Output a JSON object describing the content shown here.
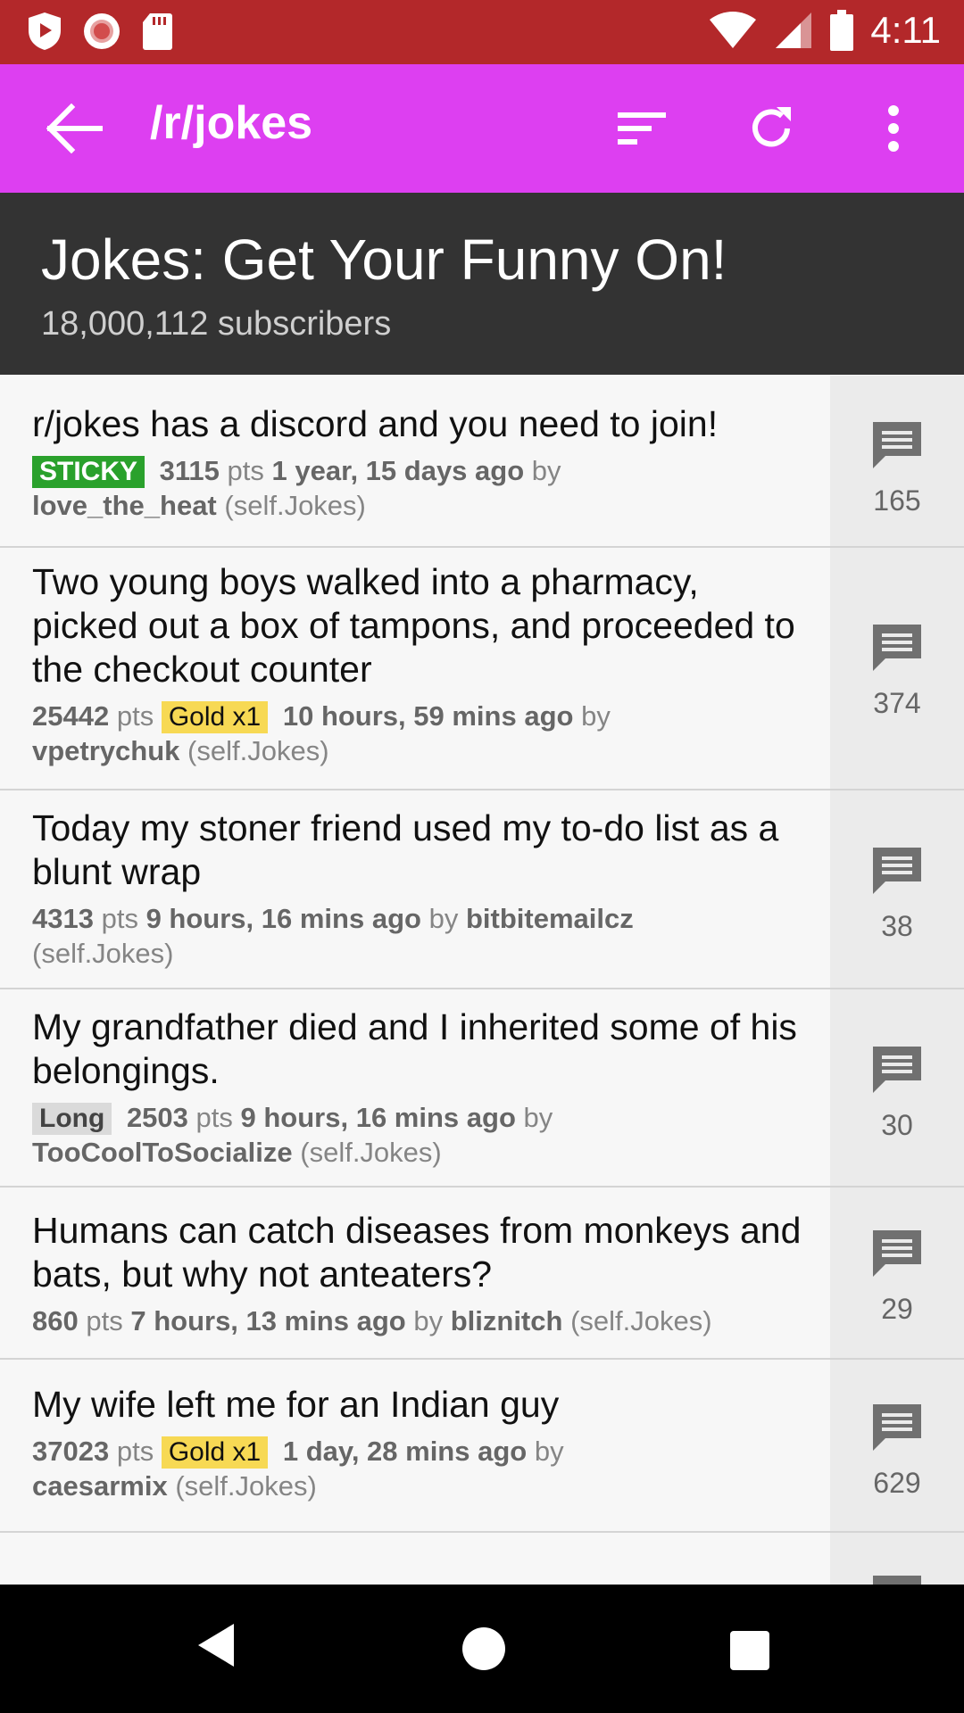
{
  "status_bar": {
    "time": "4:11",
    "icons": [
      "shield-icon",
      "record-icon",
      "sdcard-icon",
      "wifi-icon",
      "signal-icon",
      "battery-icon"
    ]
  },
  "app_bar": {
    "title": "/r/jokes",
    "icons": [
      "back-arrow-icon",
      "sort-icon",
      "refresh-icon",
      "more-vert-icon"
    ]
  },
  "subreddit": {
    "title": "Jokes: Get Your Funny On!",
    "subscribers": "18,000,112 subscribers"
  },
  "posts": [
    {
      "title": "r/jokes has a discord and you need to join!",
      "tag": "STICKY",
      "points": "3115",
      "pts_label": "pts",
      "time": "1 year, 15 days ago",
      "by_label": "by",
      "author": "love_the_heat",
      "source": "(self.Jokes)",
      "comments": "165"
    },
    {
      "title": "Two young boys walked into a pharmacy, picked out a box of tampons, and proceeded to the checkout counter",
      "points": "25442",
      "pts_label": "pts",
      "tag": "Gold x1",
      "time": "10 hours, 59 mins ago",
      "by_label": "by",
      "author": "vpetrychuk",
      "source": "(self.Jokes)",
      "comments": "374"
    },
    {
      "title": "Today my stoner friend used my to-do list as a blunt wrap",
      "points": "4313",
      "pts_label": "pts",
      "time": "9 hours, 16 mins ago",
      "by_label": "by",
      "author": "bitbitemailcz",
      "source": "(self.Jokes)",
      "comments": "38"
    },
    {
      "title": "My grandfather died and I inherited some of his belongings.",
      "tag": "Long",
      "points": "2503",
      "pts_label": "pts",
      "time": "9 hours, 16 mins ago",
      "by_label": "by",
      "author": "TooCoolToSocialize",
      "source": "(self.Jokes)",
      "comments": "30"
    },
    {
      "title": "Humans can catch diseases from monkeys and bats, but why not anteaters?",
      "points": "860",
      "pts_label": "pts",
      "time": "7 hours, 13 mins ago",
      "by_label": "by",
      "author": "bliznitch",
      "source": "(self.Jokes)",
      "comments": "29"
    },
    {
      "title": "My wife left me for an Indian guy",
      "points": "37023",
      "pts_label": "pts",
      "tag": "Gold x1",
      "time": "1 day, 28 mins ago",
      "by_label": "by",
      "author": "caesarmix",
      "source": "(self.Jokes)",
      "comments": "629"
    }
  ],
  "nav_bar": {
    "icons": [
      "nav-back-icon",
      "nav-home-icon",
      "nav-recents-icon"
    ]
  },
  "colors": {
    "status_bar": "#b3282a",
    "app_bar": "#dd3ff1",
    "sub_header": "#333333",
    "sticky_tag": "#2aa12c",
    "gold_tag": "#f7d954"
  }
}
